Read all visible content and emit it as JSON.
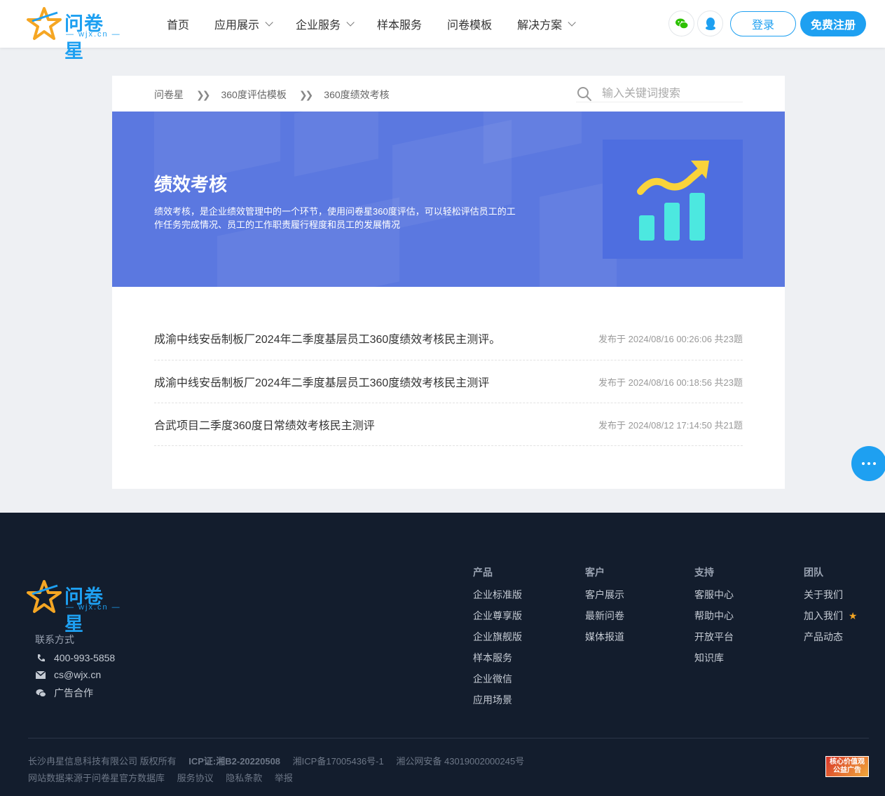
{
  "header": {
    "brand": "问卷星",
    "brand_sub": "— wjx.cn —",
    "nav": [
      {
        "label": "首页",
        "dropdown": false
      },
      {
        "label": "应用展示",
        "dropdown": true
      },
      {
        "label": "企业服务",
        "dropdown": true
      },
      {
        "label": "样本服务",
        "dropdown": false
      },
      {
        "label": "问卷模板",
        "dropdown": false
      },
      {
        "label": "解决方案",
        "dropdown": true
      }
    ],
    "login_label": "登录",
    "register_label": "免费注册",
    "accent": "#1ea0f1"
  },
  "breadcrumb": {
    "items": [
      "问卷星",
      "360度评估模板",
      "360度绩效考核"
    ],
    "separator": "»"
  },
  "search": {
    "placeholder": "输入关键词搜索"
  },
  "banner": {
    "title": "绩效考核",
    "description": "绩效考核，是企业绩效管理中的一个环节，使用问卷星360度评估，可以轻松评估员工的工作任务完成情况、员工的工作职责履行程度和员工的发展情况",
    "bg_color": "#5b78e0"
  },
  "list": [
    {
      "title": "成渝中线安岳制板厂2024年二季度基层员工360度绩效考核民主测评。",
      "meta": "发布于 2024/08/16 00:26:06 共23题"
    },
    {
      "title": "成渝中线安岳制板厂2024年二季度基层员工360度绩效考核民主测评",
      "meta": "发布于 2024/08/16 00:18:56 共23题"
    },
    {
      "title": "合武项目二季度360度日常绩效考核民主测评",
      "meta": "发布于 2024/08/12 17:14:50 共21题"
    }
  ],
  "footer": {
    "brand": "问卷星",
    "brand_sub": "— wjx.cn —",
    "contact_title": "联系方式",
    "phone": "400-993-5858",
    "email": "cs@wjx.cn",
    "ad": "广告合作",
    "columns": [
      {
        "head": "产品",
        "links": [
          "企业标准版",
          "企业尊享版",
          "企业旗舰版",
          "样本服务",
          "企业微信",
          "应用场景"
        ]
      },
      {
        "head": "客户",
        "links": [
          "客户展示",
          "最新问卷",
          "媒体报道"
        ]
      },
      {
        "head": "支持",
        "links": [
          "客服中心",
          "帮助中心",
          "开放平台",
          "知识库"
        ]
      },
      {
        "head": "团队",
        "links": [
          "关于我们",
          "加入我们",
          "产品动态"
        ]
      }
    ],
    "bottom_line1": [
      "长沙冉星信息科技有限公司 版权所有",
      "ICP证:湘B2-20220508",
      "湘ICP备17005436号-1",
      "湘公网安备 43019002000245号"
    ],
    "bottom_line2": [
      "网站数据来源于问卷星官方数据库",
      "服务协议",
      "隐私条款",
      "举报"
    ],
    "badge": "核心价值观 公益广告"
  }
}
